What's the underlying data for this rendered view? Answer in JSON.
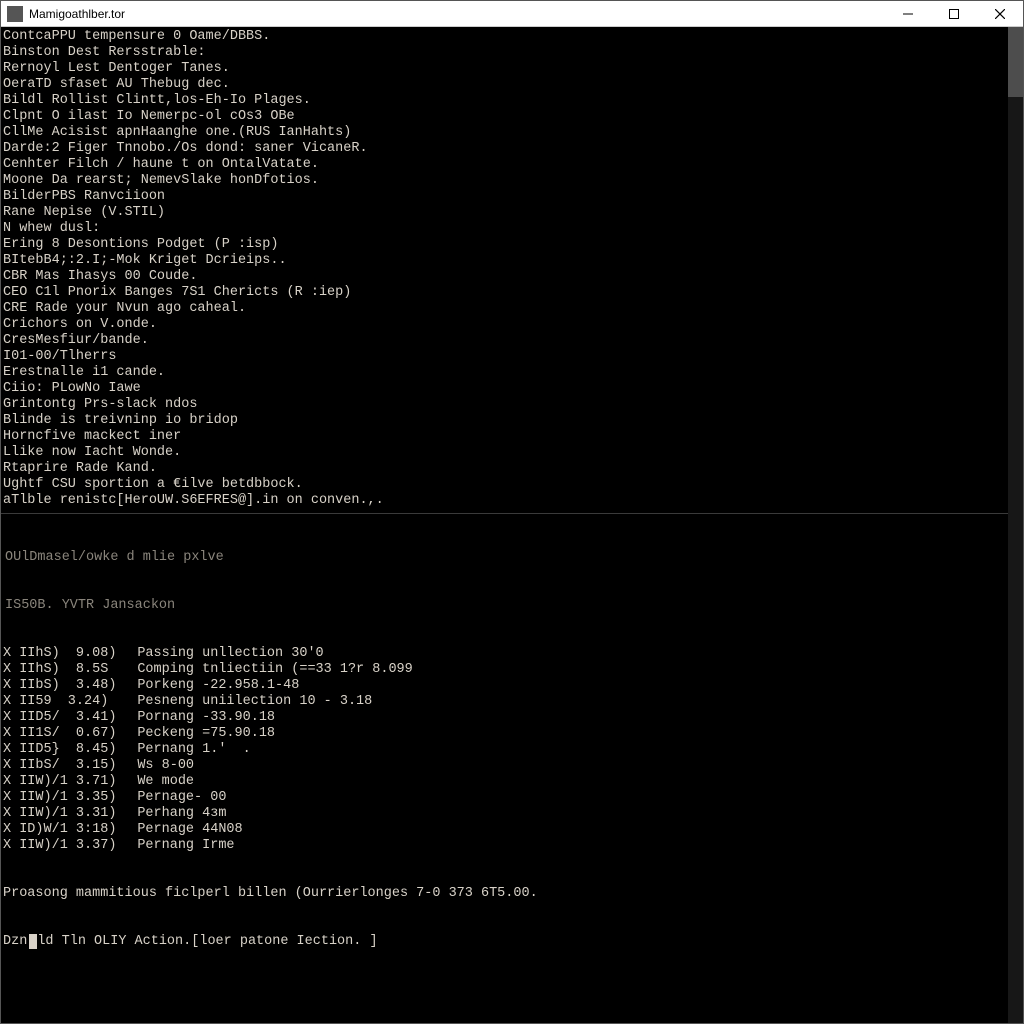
{
  "titlebar": {
    "title": "Mamigoathlber.tor"
  },
  "top_lines": [
    "ContcaPPU tempensure 0 Oame/DBBS.",
    "Binston Dest Rersstrable:",
    "Rernoyl Lest Dentoger Tanes.",
    "OeraTD sfaset AU Thebug dec.",
    "Bildl Rollist Clintt,los-Eh-Io Plages.",
    "Clpnt O ilast Io Nemerpc-ol cOs3 OBe",
    "CllMe Acisist apnHaanghe one.(RUS IanHahts)",
    "Darde:2 Figer Tnnobo./Os dond: saner VicaneR.",
    "Cenhter Filch / haune t on OntalVatate.",
    "Moone Da rearst; NemevSlake honDfotios.",
    "BilderPBS Ranvciioon",
    "Rane Nepise (V.STIL)",
    "N whew dusl:",
    "Ering 8 Desontions Podget (P :isp)",
    "BItebB4;:2.I;-Mok Kriget Dcrieips..",
    "CBR Mas Ihasys 00 Coude.",
    "CEO C1l Pnorix Banges 7S1 Chericts (R :iep)",
    "CRE Rade your Nvun ago caheal.",
    "Crichors on V.onde.",
    "CresMesfiur/bande.",
    "I01-00/Tlherrs",
    "Erestnalle i1 cande.",
    "Ciio: PLowNo Iawe",
    "Grintontg Prs-slack ndos",
    "Blinde is treivninp io bridop",
    "Horncfive mackect iner",
    "Llike now Iacht Wonde.",
    "Rtaprire Rade Kand.",
    "Ughtf CSU sportion a €ilve betdbbock.",
    "aTlble renistc[HeroUW.S6EFRES@].in on conven.,."
  ],
  "mid_header1": "OUlDmasel/owke d mlie pxlve",
  "mid_header2": "IS50B. YVTR Jansackon",
  "rows": [
    {
      "id": "X IIhS)  9.08)",
      "msg": "Passing unllection 30'0"
    },
    {
      "id": "X IIhS)  8.5S",
      "msg": "Comping tnliectiin (==33 1?r 8.099"
    },
    {
      "id": "X IIbS)  3.48)",
      "msg": "Porkeng -22.958.1-48"
    },
    {
      "id": "X II59  3.24)",
      "msg": "Pesneng uniilection 10 - 3.18"
    },
    {
      "id": "X IID5/  3.41)",
      "msg": "Pornang -33.90.18"
    },
    {
      "id": "X II1S/  0.67)",
      "msg": "Peckeng =75.90.18"
    },
    {
      "id": "X IID5}  8.45)",
      "msg": "Pernang 1.'  ."
    },
    {
      "id": "X IIbS/  3.15)",
      "msg": "Ws 8-00"
    },
    {
      "id": "X IIW)/1 3.71)",
      "msg": "We mode"
    },
    {
      "id": "X IIW)/1 3.35)",
      "msg": "Pernage- 00"
    },
    {
      "id": "X IIW)/1 3.31)",
      "msg": "Perhang 4зm"
    },
    {
      "id": "X ID)W/1 3:18)",
      "msg": "Pernage 44N08"
    },
    {
      "id": "X IIW)/1 3.37)",
      "msg": "Pernang Irme"
    }
  ],
  "footer1": "Proasong mammitious ficlperl billen (Ourrierlonges 7-0 373 6T5.00.",
  "footer2": "Dznld Tln OLIY Action.[loer patone Iection. ]"
}
